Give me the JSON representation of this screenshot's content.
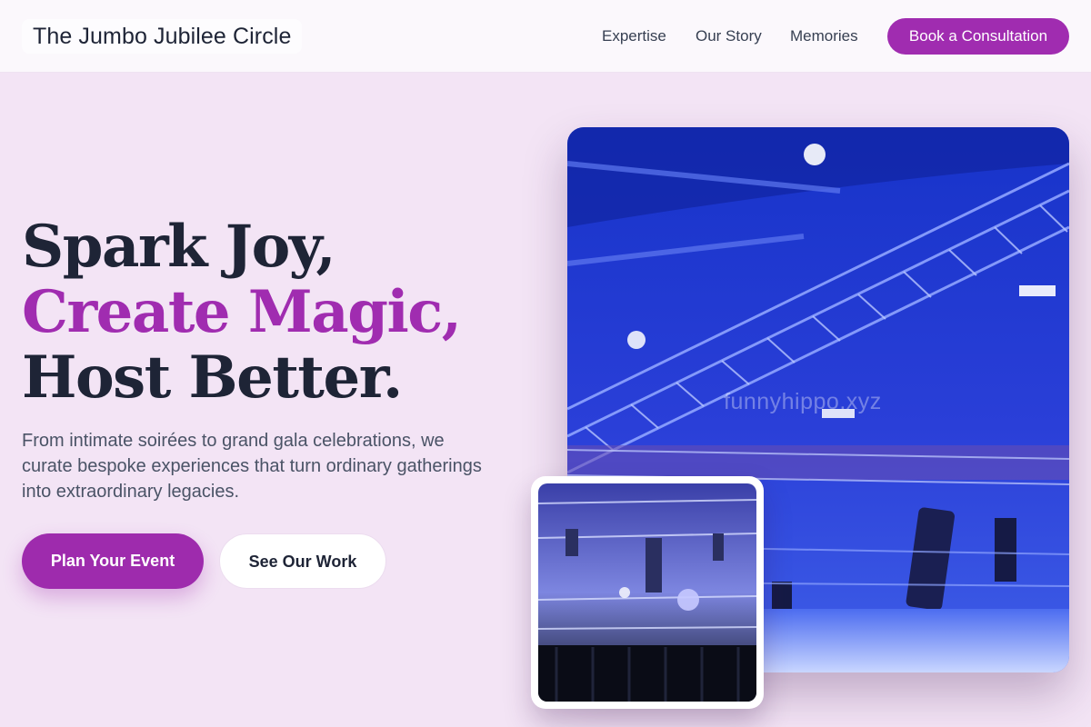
{
  "header": {
    "brand": "The Jumbo Jubilee Circle",
    "nav": [
      "Expertise",
      "Our Story",
      "Memories"
    ],
    "cta": "Book a Consultation"
  },
  "hero": {
    "headline_line1": "Spark Joy,",
    "headline_line2": "Create Magic,",
    "headline_line3": "Host Better.",
    "subtext": "From intimate soirées to grand gala celebrations, we curate bespoke experiences that turn ordinary gatherings into extraordinary legacies.",
    "primary_button": "Plan Your Event",
    "secondary_button": "See Our Work",
    "image_watermark": "funnyhippo.xyz"
  },
  "colors": {
    "accent": "#a02cb0",
    "text_dark": "#1e2436",
    "background": "#f3e4f5"
  },
  "images": {
    "main": "stage-truss-blue-lights-photo",
    "inset": "concert-stage-rigging-photo"
  }
}
